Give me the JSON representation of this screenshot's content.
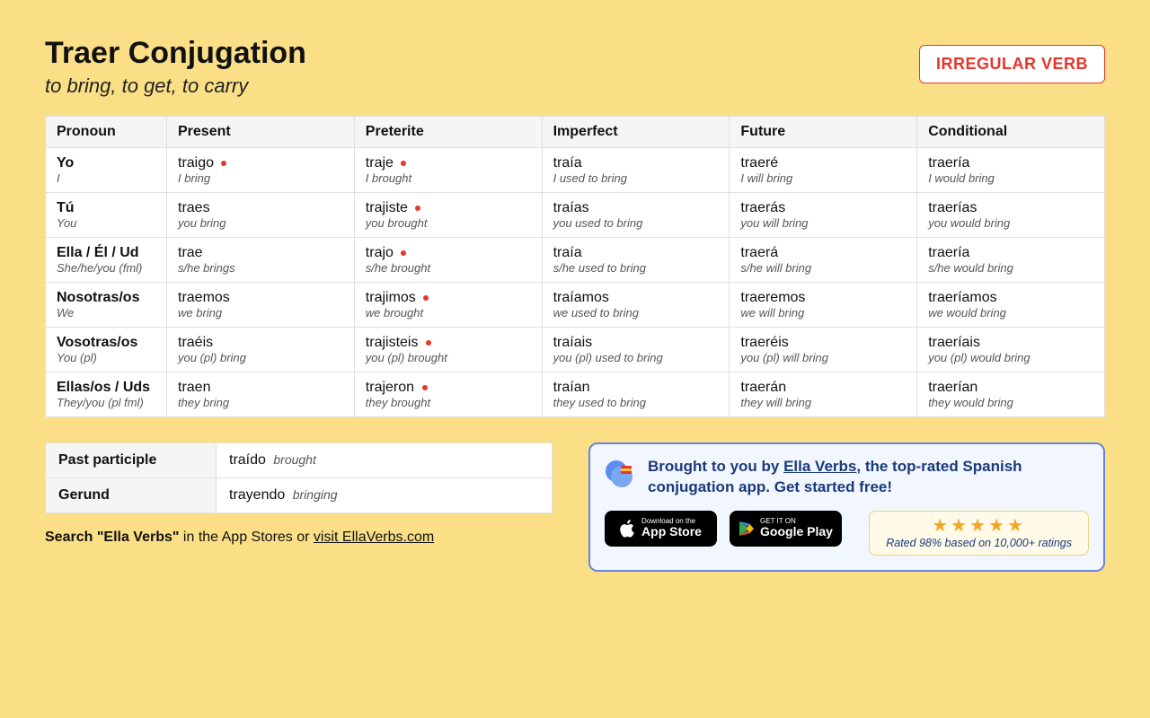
{
  "header": {
    "verb": "Traer",
    "title_rest": " Conjugation",
    "subtitle": "to bring, to get, to carry",
    "badge": "IRREGULAR VERB"
  },
  "columns": [
    "Pronoun",
    "Present",
    "Preterite",
    "Imperfect",
    "Future",
    "Conditional"
  ],
  "rows": [
    {
      "pronoun": {
        "main": "Yo",
        "sub": "I"
      },
      "forms": [
        {
          "main": "traigo",
          "sub": "I bring",
          "irregular": true
        },
        {
          "main": "traje",
          "sub": "I brought",
          "irregular": true
        },
        {
          "main": "traía",
          "sub": "I used to bring",
          "irregular": false
        },
        {
          "main": "traeré",
          "sub": "I will bring",
          "irregular": false
        },
        {
          "main": "traería",
          "sub": "I would bring",
          "irregular": false
        }
      ]
    },
    {
      "pronoun": {
        "main": "Tú",
        "sub": "You"
      },
      "forms": [
        {
          "main": "traes",
          "sub": "you bring",
          "irregular": false
        },
        {
          "main": "trajiste",
          "sub": "you brought",
          "irregular": true
        },
        {
          "main": "traías",
          "sub": "you used to bring",
          "irregular": false
        },
        {
          "main": "traerás",
          "sub": "you will bring",
          "irregular": false
        },
        {
          "main": "traerías",
          "sub": "you would bring",
          "irregular": false
        }
      ]
    },
    {
      "pronoun": {
        "main": "Ella / Él / Ud",
        "sub": "She/he/you (fml)"
      },
      "forms": [
        {
          "main": "trae",
          "sub": "s/he brings",
          "irregular": false
        },
        {
          "main": "trajo",
          "sub": "s/he brought",
          "irregular": true
        },
        {
          "main": "traía",
          "sub": "s/he used to bring",
          "irregular": false
        },
        {
          "main": "traerá",
          "sub": "s/he will bring",
          "irregular": false
        },
        {
          "main": "traería",
          "sub": "s/he would bring",
          "irregular": false
        }
      ]
    },
    {
      "pronoun": {
        "main": "Nosotras/os",
        "sub": "We"
      },
      "forms": [
        {
          "main": "traemos",
          "sub": "we bring",
          "irregular": false
        },
        {
          "main": "trajimos",
          "sub": "we brought",
          "irregular": true
        },
        {
          "main": "traíamos",
          "sub": "we used to bring",
          "irregular": false
        },
        {
          "main": "traeremos",
          "sub": "we will bring",
          "irregular": false
        },
        {
          "main": "traeríamos",
          "sub": "we would bring",
          "irregular": false
        }
      ]
    },
    {
      "pronoun": {
        "main": "Vosotras/os",
        "sub": "You (pl)"
      },
      "forms": [
        {
          "main": "traéis",
          "sub": "you (pl) bring",
          "irregular": false
        },
        {
          "main": "trajisteis",
          "sub": "you (pl) brought",
          "irregular": true
        },
        {
          "main": "traíais",
          "sub": "you (pl) used to bring",
          "irregular": false
        },
        {
          "main": "traeréis",
          "sub": "you (pl) will bring",
          "irregular": false
        },
        {
          "main": "traeríais",
          "sub": "you (pl) would bring",
          "irregular": false
        }
      ]
    },
    {
      "pronoun": {
        "main": "Ellas/os / Uds",
        "sub": "They/you (pl fml)"
      },
      "forms": [
        {
          "main": "traen",
          "sub": "they bring",
          "irregular": false
        },
        {
          "main": "trajeron",
          "sub": "they brought",
          "irregular": true
        },
        {
          "main": "traían",
          "sub": "they used to bring",
          "irregular": false
        },
        {
          "main": "traerán",
          "sub": "they will bring",
          "irregular": false
        },
        {
          "main": "traerían",
          "sub": "they would bring",
          "irregular": false
        }
      ]
    }
  ],
  "extra": [
    {
      "label": "Past participle",
      "value": "traído",
      "sub": "brought"
    },
    {
      "label": "Gerund",
      "value": "trayendo",
      "sub": "bringing"
    }
  ],
  "search_line": {
    "bold1": "Search \"Ella Verbs\"",
    "rest": " in the App Stores or ",
    "link": "visit EllaVerbs.com"
  },
  "promo": {
    "text1": "Brought to you by ",
    "brand": "Ella Verbs",
    "text2": ", the top-rated Spanish conjugation app. Get started free!",
    "appstore": {
      "small": "Download on the",
      "big": "App Store"
    },
    "playstore": {
      "small": "GET IT ON",
      "big": "Google Play"
    },
    "stars": "★★★★★",
    "rating_text": "Rated 98% based on 10,000+ ratings"
  }
}
